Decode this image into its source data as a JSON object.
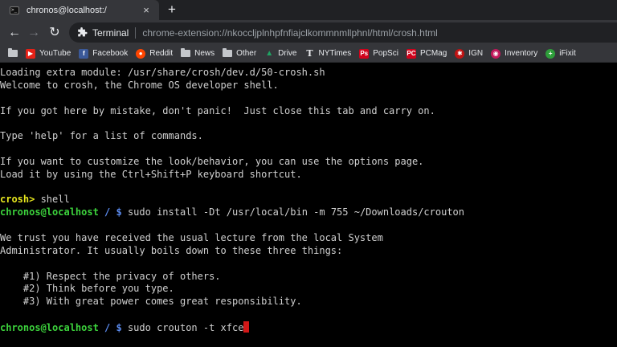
{
  "colors": {
    "tabstrip_bg": "#202124",
    "toolbar_bg": "#35363a",
    "terminal_bg": "#000000",
    "terminal_text": "#d0d0d0",
    "prompt_crosh": "#e6e61e",
    "prompt_user": "#3cd23c",
    "prompt_path": "#5c8cf0",
    "cursor": "#d21818"
  },
  "tab": {
    "title": "chronos@localhost:/",
    "favicon": "terminal-icon",
    "close_icon": "×",
    "new_tab_icon": "+"
  },
  "toolbar": {
    "back_icon": "←",
    "forward_icon": "→",
    "reload_icon": "↻",
    "site_name": "Terminal",
    "url": "chrome-extension://nkoccljplnhpfnfiajclkommnmllphnl/html/crosh.html"
  },
  "bookmarks": [
    {
      "label": "",
      "icon": "apps-icon"
    },
    {
      "label": "YouTube",
      "icon": "youtube-icon",
      "glyph": "▶",
      "color": "#e62117"
    },
    {
      "label": "Facebook",
      "icon": "facebook-icon",
      "glyph": "f",
      "color": "#3b5998"
    },
    {
      "label": "Reddit",
      "icon": "reddit-icon",
      "glyph": "●",
      "color": "#ff4500"
    },
    {
      "label": "News",
      "icon": "folder-icon"
    },
    {
      "label": "Other",
      "icon": "folder-icon"
    },
    {
      "label": "Drive",
      "icon": "drive-icon",
      "glyph": "▲",
      "color": "#1fa463"
    },
    {
      "label": "NYTimes",
      "icon": "nytimes-icon",
      "glyph": "T",
      "color": "#222222"
    },
    {
      "label": "PopSci",
      "icon": "popsci-icon",
      "glyph": "Ps",
      "color": "#d0021b"
    },
    {
      "label": "PCMag",
      "icon": "pcmag-icon",
      "glyph": "PC",
      "color": "#d0021b"
    },
    {
      "label": "IGN",
      "icon": "ign-icon",
      "glyph": "✱",
      "color": "#bf1313"
    },
    {
      "label": "Inventory",
      "icon": "inventory-icon",
      "glyph": "◉",
      "color": "#c2185b"
    },
    {
      "label": "iFixit",
      "icon": "ifixit-icon",
      "glyph": "+",
      "color": "#2e9e3a"
    }
  ],
  "terminal": {
    "lines": [
      {
        "text": "Loading extra module: /usr/share/crosh/dev.d/50-crosh.sh"
      },
      {
        "text": "Welcome to crosh, the Chrome OS developer shell."
      },
      {
        "text": ""
      },
      {
        "text": "If you got here by mistake, don't panic!  Just close this tab and carry on."
      },
      {
        "text": ""
      },
      {
        "text": "Type 'help' for a list of commands."
      },
      {
        "text": ""
      },
      {
        "text": "If you want to customize the look/behavior, you can use the options page."
      },
      {
        "text": "Load it by using the Ctrl+Shift+P keyboard shortcut."
      },
      {
        "text": ""
      },
      {
        "crosh": "crosh>",
        "cmd": " shell"
      },
      {
        "user": "chronos@localhost",
        "path": " / $",
        "cmd": " sudo install -Dt /usr/local/bin -m 755 ~/Downloads/crouton"
      },
      {
        "text": ""
      },
      {
        "text": "We trust you have received the usual lecture from the local System"
      },
      {
        "text": "Administrator. It usually boils down to these three things:"
      },
      {
        "text": ""
      },
      {
        "text": "    #1) Respect the privacy of others."
      },
      {
        "text": "    #2) Think before you type."
      },
      {
        "text": "    #3) With great power comes great responsibility."
      },
      {
        "text": ""
      },
      {
        "user": "chronos@localhost",
        "path": " / $",
        "cmd": " sudo crouton -t xfce",
        "cursor": true
      }
    ]
  }
}
